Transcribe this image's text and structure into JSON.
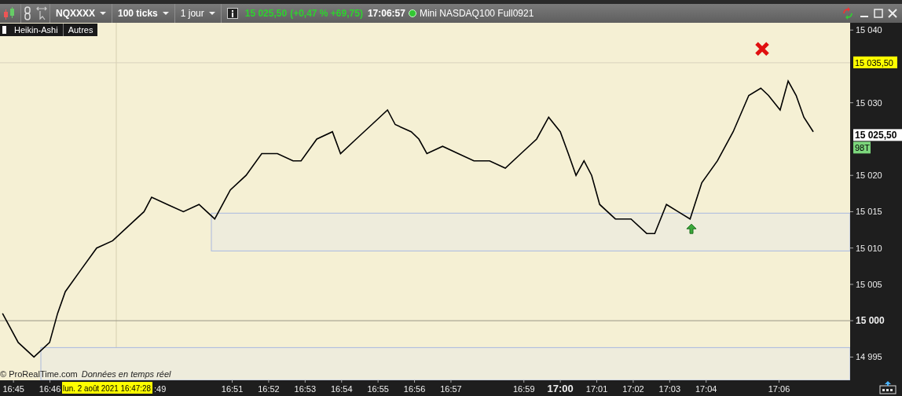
{
  "toolbar": {
    "interval": "100 ticks",
    "period": "1 jour",
    "price": "15 025,50",
    "change": "(+0,47 % +69,75)",
    "time": "17:06:57",
    "instrument": "Mini NASDAQ100 Full0921",
    "connected": true
  },
  "chart_tabs": [
    {
      "label": "Heikin-Ashi"
    },
    {
      "label": "Autres"
    }
  ],
  "attribution": "© ProRealTime.com",
  "realtime_note": "Données en temps réel",
  "crosshair_label": "lun. 2 août 2021 16:47:28",
  "covered_time_label": ":49",
  "price_tags": [
    {
      "label": "15 035,50",
      "kind": "alert"
    },
    {
      "label": "15 025,50",
      "kind": "last"
    },
    {
      "label": "98T",
      "kind": "ticks"
    }
  ],
  "chart_data": {
    "type": "line",
    "xlim": [
      1004.63,
      1027.95
    ],
    "ref_lines": [
      {
        "axis": "x",
        "value": 1007.82,
        "color": "#d6cfb0"
      },
      {
        "axis": "y",
        "value": 15035.5,
        "color": "#d8d2bc"
      },
      {
        "axis": "y",
        "value": 15000,
        "color": "#9a9688"
      }
    ],
    "x": [
      1004.7,
      1005.13,
      1005.56,
      1005.99,
      1006.21,
      1006.42,
      1006.85,
      1007.28,
      1007.72,
      1008.15,
      1008.58,
      1008.79,
      1009.22,
      1009.66,
      1010.09,
      1010.52,
      1010.95,
      1011.38,
      1011.81,
      1012.24,
      1012.67,
      1012.89,
      1013.32,
      1013.75,
      1013.97,
      1014.4,
      1014.83,
      1015.26,
      1015.47,
      1015.91,
      1016.12,
      1016.34,
      1016.77,
      1017.2,
      1017.63,
      1018.06,
      1018.49,
      1018.92,
      1019.35,
      1019.68,
      1020,
      1020.22,
      1020.43,
      1020.65,
      1020.86,
      1021.08,
      1021.51,
      1021.94,
      1022.37,
      1022.59,
      1022.91,
      1023.23,
      1023.56,
      1023.88,
      1024.31,
      1024.74,
      1025.17,
      1025.5,
      1025.71,
      1026.03,
      1026.25,
      1026.47,
      1026.68,
      1026.94
    ],
    "series": [
      {
        "name": "NQXXXX",
        "color": "#000000",
        "values": [
          15001,
          14997,
          14995,
          14997,
          15001,
          15004,
          15007,
          15010,
          15011,
          15013,
          15015,
          15017,
          15016,
          15015,
          15016,
          15014,
          15018,
          15020,
          15023,
          15023,
          15022,
          15022,
          15025,
          15026,
          15023,
          15025,
          15027,
          15029,
          15027,
          15026,
          15025,
          15023,
          15024,
          15023,
          15022,
          15022,
          15021,
          15023,
          15025,
          15028,
          15026,
          15023,
          15020,
          15022,
          15020,
          15016,
          15014,
          15014,
          15012,
          15012,
          15016,
          15015,
          15014,
          15019,
          15022,
          15026,
          15031,
          15032,
          15031,
          15029,
          15033,
          15031,
          15028,
          15026
        ]
      }
    ],
    "ylim": [
      14991.8,
      15041
    ],
    "yticks": [
      {
        "value": 15040,
        "label": "15 040"
      },
      {
        "value": 15030,
        "label": "15 030"
      },
      {
        "value": 15020,
        "label": "15 020"
      },
      {
        "value": 15015,
        "label": "15 015"
      },
      {
        "value": 15010,
        "label": "15 010"
      },
      {
        "value": 15005,
        "label": "15 005"
      },
      {
        "value": 15000,
        "label": "15 000"
      },
      {
        "value": 14995,
        "label": "14 995"
      }
    ],
    "xticks": [
      {
        "value": 1005,
        "label": "16:45"
      },
      {
        "value": 1006,
        "label": "16:46"
      },
      {
        "value": 1011,
        "label": "16:51"
      },
      {
        "value": 1012,
        "label": "16:52"
      },
      {
        "value": 1013,
        "label": "16:53"
      },
      {
        "value": 1014,
        "label": "16:54"
      },
      {
        "value": 1015,
        "label": "16:55"
      },
      {
        "value": 1016,
        "label": "16:56"
      },
      {
        "value": 1017,
        "label": "16:57"
      },
      {
        "value": 1019,
        "label": "16:59"
      },
      {
        "value": 1020,
        "label": "17:00"
      },
      {
        "value": 1021,
        "label": "17:01"
      },
      {
        "value": 1022,
        "label": "17:02"
      },
      {
        "value": 1023,
        "label": "17:03"
      },
      {
        "value": 1024,
        "label": "17:04"
      },
      {
        "value": 1026,
        "label": "17:06"
      }
    ]
  }
}
